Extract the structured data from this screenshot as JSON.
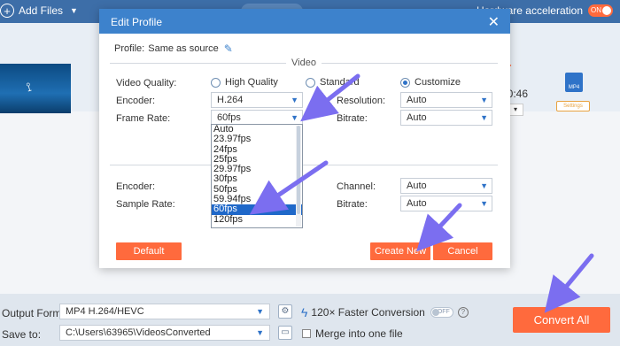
{
  "app": {
    "add_files": "Add Files",
    "hw_accel": "Hardware acceleration",
    "hw_toggle": "ON",
    "duration": "00:46",
    "format_icon": "MP4",
    "settings_label": "Settings"
  },
  "dialog": {
    "title": "Edit Profile",
    "profile_label": "Profile:",
    "profile_value": "Same as source",
    "video_section": "Video",
    "video_quality_label": "Video Quality:",
    "quality_options": [
      "High Quality",
      "Standard",
      "Customize"
    ],
    "quality_selected": "Customize",
    "encoder_label": "Encoder:",
    "encoder_value": "H.264",
    "resolution_label": "Resolution:",
    "resolution_value": "Auto",
    "frame_rate_label": "Frame Rate:",
    "frame_rate_value": "60fps",
    "bitrate_label": "Bitrate:",
    "bitrate_value": "Auto",
    "frame_rate_options": [
      "Auto",
      "23.97fps",
      "24fps",
      "25fps",
      "29.97fps",
      "30fps",
      "50fps",
      "59.94fps",
      "60fps",
      "120fps"
    ],
    "frame_rate_highlighted": "60fps",
    "audio_encoder_label": "Encoder:",
    "sample_rate_label": "Sample Rate:",
    "channel_label": "Channel:",
    "channel_value": "Auto",
    "audio_bitrate_label": "Bitrate:",
    "audio_bitrate_value": "Auto",
    "default_btn": "Default",
    "create_new_btn": "Create New",
    "cancel_btn": "Cancel"
  },
  "bottom": {
    "output_format_label": "Output Format:",
    "output_format_value": "MP4 H.264/HEVC",
    "save_to_label": "Save to:",
    "save_to_value": "C:\\Users\\63965\\VideosConverted",
    "faster_conversion": "120× Faster Conversion",
    "faster_toggle": "OFF",
    "merge_label": "Merge into one file",
    "convert_all": "Convert All"
  },
  "colors": {
    "accent_orange": "#ff6a3d",
    "header_blue": "#3d82cc",
    "selection_blue": "#1f68c9",
    "arrow_purple": "#7b6ef0"
  }
}
